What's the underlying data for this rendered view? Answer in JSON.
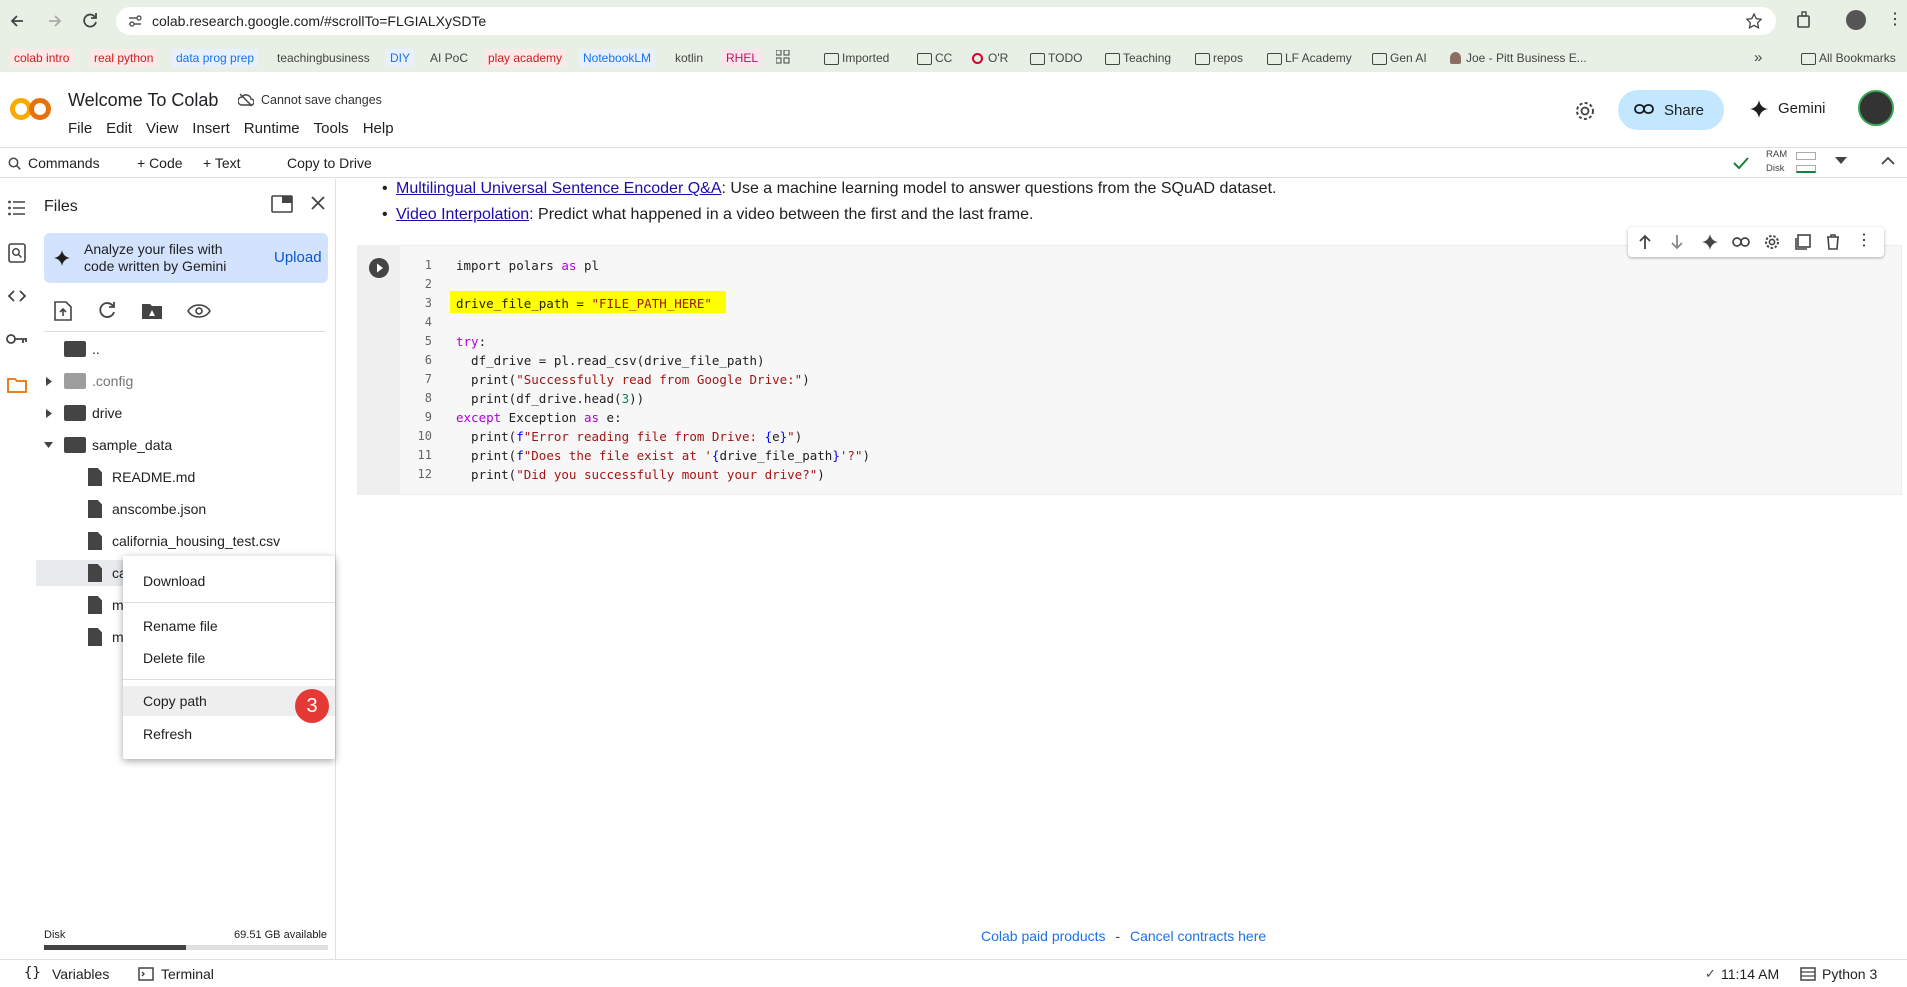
{
  "browser": {
    "url": "colab.research.google.com/#scrollTo=FLGIALXySDTe",
    "bookmarks": [
      "colab intro",
      "real python",
      "data prog prep",
      "teachingbusiness",
      "DIY",
      "AI PoC",
      "play academy",
      "NotebookLM",
      "kotlin",
      "RHEL"
    ],
    "bookmark_folders": [
      "Imported",
      "CC",
      "O'R",
      "TODO",
      "Teaching",
      "repos",
      "LF Academy",
      "Gen AI",
      "Joe - Pitt Business E..."
    ],
    "all_bookmarks": "All Bookmarks"
  },
  "header": {
    "title": "Welcome To Colab",
    "save_status": "Cannot save changes",
    "menu": [
      "File",
      "Edit",
      "View",
      "Insert",
      "Runtime",
      "Tools",
      "Help"
    ],
    "share_label": "Share",
    "gemini_label": "Gemini"
  },
  "toolbar": {
    "commands": "Commands",
    "code": "+ Code",
    "text": "+ Text",
    "copy_to_drive": "Copy to Drive",
    "ram": "RAM",
    "disk": "Disk"
  },
  "files_panel": {
    "title": "Files",
    "gemini_promo": "Analyze your files with code written by Gemini",
    "upload": "Upload",
    "tree": [
      {
        "name": "..",
        "kind": "parent"
      },
      {
        "name": ".config",
        "kind": "folder"
      },
      {
        "name": "drive",
        "kind": "folder"
      },
      {
        "name": "sample_data",
        "kind": "folder"
      },
      {
        "name": "README.md",
        "kind": "file"
      },
      {
        "name": "anscombe.json",
        "kind": "file"
      },
      {
        "name": "california_housing_test.csv",
        "kind": "file"
      },
      {
        "name": "ca",
        "kind": "file"
      },
      {
        "name": "m",
        "kind": "file"
      },
      {
        "name": "m",
        "kind": "file"
      }
    ],
    "disk_label": "Disk",
    "disk_available": "69.51 GB available",
    "disk_used_fraction": 0.5
  },
  "context_menu": {
    "items": [
      "Download",
      "Rename file",
      "Delete file",
      "Copy path",
      "Refresh"
    ],
    "badge": "3"
  },
  "links": {
    "item1_link": "Multilingual Universal Sentence Encoder Q&A",
    "item1_text": ": Use a machine learning model to answer questions from the SQuAD dataset.",
    "item2_link": "Video Interpolation",
    "item2_text": ": Predict what happened in a video between the first and the last frame."
  },
  "code": {
    "line_numbers": [
      "1",
      "2",
      "3",
      "4",
      "5",
      "6",
      "7",
      "8",
      "9",
      "10",
      "11",
      "12"
    ]
  },
  "footer": {
    "paid": "Colab paid products",
    "dash": "-",
    "cancel": "Cancel contracts here",
    "variables": "Variables",
    "terminal": "Terminal",
    "time": "11:14 AM",
    "runtime": "Python 3"
  }
}
